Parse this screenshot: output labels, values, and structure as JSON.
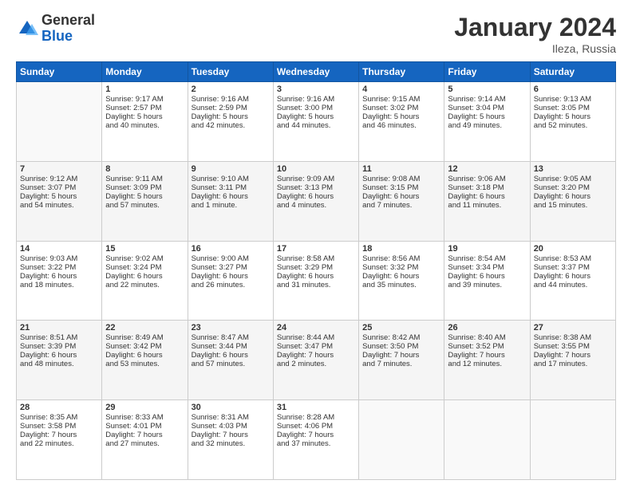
{
  "header": {
    "logo_general": "General",
    "logo_blue": "Blue",
    "month_title": "January 2024",
    "location": "Ileza, Russia"
  },
  "weekdays": [
    "Sunday",
    "Monday",
    "Tuesday",
    "Wednesday",
    "Thursday",
    "Friday",
    "Saturday"
  ],
  "weeks": [
    [
      {
        "day": "",
        "info": ""
      },
      {
        "day": "1",
        "info": "Sunrise: 9:17 AM\nSunset: 2:57 PM\nDaylight: 5 hours\nand 40 minutes."
      },
      {
        "day": "2",
        "info": "Sunrise: 9:16 AM\nSunset: 2:59 PM\nDaylight: 5 hours\nand 42 minutes."
      },
      {
        "day": "3",
        "info": "Sunrise: 9:16 AM\nSunset: 3:00 PM\nDaylight: 5 hours\nand 44 minutes."
      },
      {
        "day": "4",
        "info": "Sunrise: 9:15 AM\nSunset: 3:02 PM\nDaylight: 5 hours\nand 46 minutes."
      },
      {
        "day": "5",
        "info": "Sunrise: 9:14 AM\nSunset: 3:04 PM\nDaylight: 5 hours\nand 49 minutes."
      },
      {
        "day": "6",
        "info": "Sunrise: 9:13 AM\nSunset: 3:05 PM\nDaylight: 5 hours\nand 52 minutes."
      }
    ],
    [
      {
        "day": "7",
        "info": "Sunrise: 9:12 AM\nSunset: 3:07 PM\nDaylight: 5 hours\nand 54 minutes."
      },
      {
        "day": "8",
        "info": "Sunrise: 9:11 AM\nSunset: 3:09 PM\nDaylight: 5 hours\nand 57 minutes."
      },
      {
        "day": "9",
        "info": "Sunrise: 9:10 AM\nSunset: 3:11 PM\nDaylight: 6 hours\nand 1 minute."
      },
      {
        "day": "10",
        "info": "Sunrise: 9:09 AM\nSunset: 3:13 PM\nDaylight: 6 hours\nand 4 minutes."
      },
      {
        "day": "11",
        "info": "Sunrise: 9:08 AM\nSunset: 3:15 PM\nDaylight: 6 hours\nand 7 minutes."
      },
      {
        "day": "12",
        "info": "Sunrise: 9:06 AM\nSunset: 3:18 PM\nDaylight: 6 hours\nand 11 minutes."
      },
      {
        "day": "13",
        "info": "Sunrise: 9:05 AM\nSunset: 3:20 PM\nDaylight: 6 hours\nand 15 minutes."
      }
    ],
    [
      {
        "day": "14",
        "info": "Sunrise: 9:03 AM\nSunset: 3:22 PM\nDaylight: 6 hours\nand 18 minutes."
      },
      {
        "day": "15",
        "info": "Sunrise: 9:02 AM\nSunset: 3:24 PM\nDaylight: 6 hours\nand 22 minutes."
      },
      {
        "day": "16",
        "info": "Sunrise: 9:00 AM\nSunset: 3:27 PM\nDaylight: 6 hours\nand 26 minutes."
      },
      {
        "day": "17",
        "info": "Sunrise: 8:58 AM\nSunset: 3:29 PM\nDaylight: 6 hours\nand 31 minutes."
      },
      {
        "day": "18",
        "info": "Sunrise: 8:56 AM\nSunset: 3:32 PM\nDaylight: 6 hours\nand 35 minutes."
      },
      {
        "day": "19",
        "info": "Sunrise: 8:54 AM\nSunset: 3:34 PM\nDaylight: 6 hours\nand 39 minutes."
      },
      {
        "day": "20",
        "info": "Sunrise: 8:53 AM\nSunset: 3:37 PM\nDaylight: 6 hours\nand 44 minutes."
      }
    ],
    [
      {
        "day": "21",
        "info": "Sunrise: 8:51 AM\nSunset: 3:39 PM\nDaylight: 6 hours\nand 48 minutes."
      },
      {
        "day": "22",
        "info": "Sunrise: 8:49 AM\nSunset: 3:42 PM\nDaylight: 6 hours\nand 53 minutes."
      },
      {
        "day": "23",
        "info": "Sunrise: 8:47 AM\nSunset: 3:44 PM\nDaylight: 6 hours\nand 57 minutes."
      },
      {
        "day": "24",
        "info": "Sunrise: 8:44 AM\nSunset: 3:47 PM\nDaylight: 7 hours\nand 2 minutes."
      },
      {
        "day": "25",
        "info": "Sunrise: 8:42 AM\nSunset: 3:50 PM\nDaylight: 7 hours\nand 7 minutes."
      },
      {
        "day": "26",
        "info": "Sunrise: 8:40 AM\nSunset: 3:52 PM\nDaylight: 7 hours\nand 12 minutes."
      },
      {
        "day": "27",
        "info": "Sunrise: 8:38 AM\nSunset: 3:55 PM\nDaylight: 7 hours\nand 17 minutes."
      }
    ],
    [
      {
        "day": "28",
        "info": "Sunrise: 8:35 AM\nSunset: 3:58 PM\nDaylight: 7 hours\nand 22 minutes."
      },
      {
        "day": "29",
        "info": "Sunrise: 8:33 AM\nSunset: 4:01 PM\nDaylight: 7 hours\nand 27 minutes."
      },
      {
        "day": "30",
        "info": "Sunrise: 8:31 AM\nSunset: 4:03 PM\nDaylight: 7 hours\nand 32 minutes."
      },
      {
        "day": "31",
        "info": "Sunrise: 8:28 AM\nSunset: 4:06 PM\nDaylight: 7 hours\nand 37 minutes."
      },
      {
        "day": "",
        "info": ""
      },
      {
        "day": "",
        "info": ""
      },
      {
        "day": "",
        "info": ""
      }
    ]
  ]
}
